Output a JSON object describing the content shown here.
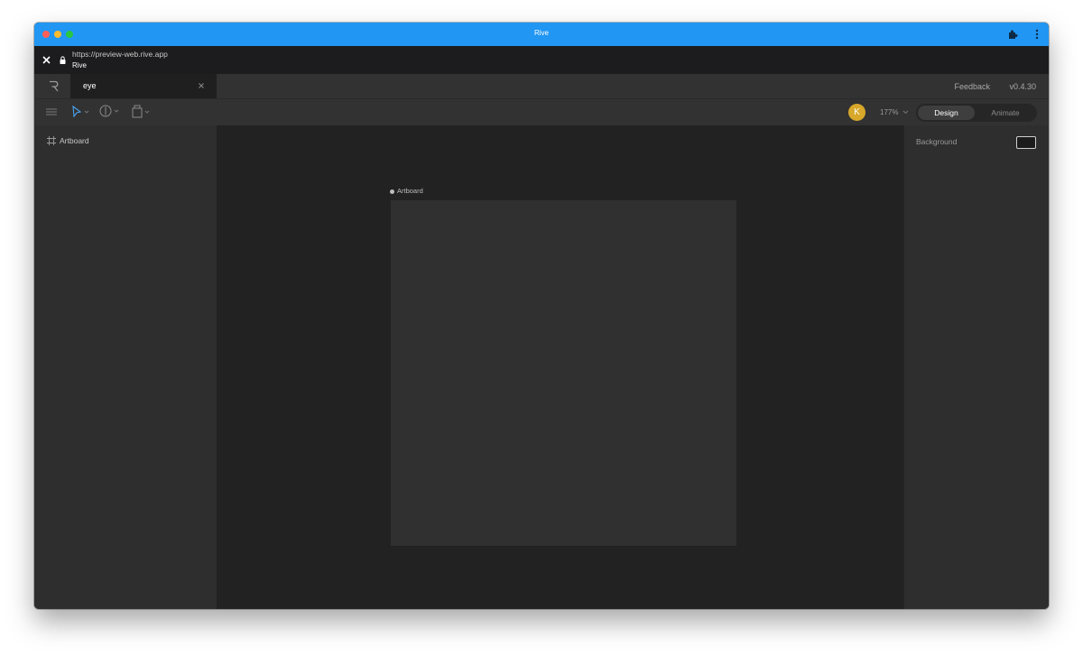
{
  "window": {
    "title": "Rive"
  },
  "browser": {
    "url": "https://preview-web.rive.app",
    "site_name": "Rive"
  },
  "tabs": [
    {
      "label": "eye",
      "active": true
    }
  ],
  "header_links": {
    "feedback": "Feedback",
    "version": "v0.4.30"
  },
  "toolbar": {
    "avatar_initial": "K",
    "zoom": "177%",
    "modes": {
      "design": "Design",
      "animate": "Animate",
      "active": "Design"
    }
  },
  "hierarchy": {
    "items": [
      {
        "label": "Artboard",
        "icon": "artboard-icon"
      }
    ]
  },
  "stage": {
    "artboard_label": "Artboard"
  },
  "inspector": {
    "background_label": "Background",
    "background_color": "#1c1c1c"
  },
  "colors": {
    "titlebar": "#2196f3",
    "avatar": "#d7a82a",
    "select_tool": "#4aa3f0"
  }
}
